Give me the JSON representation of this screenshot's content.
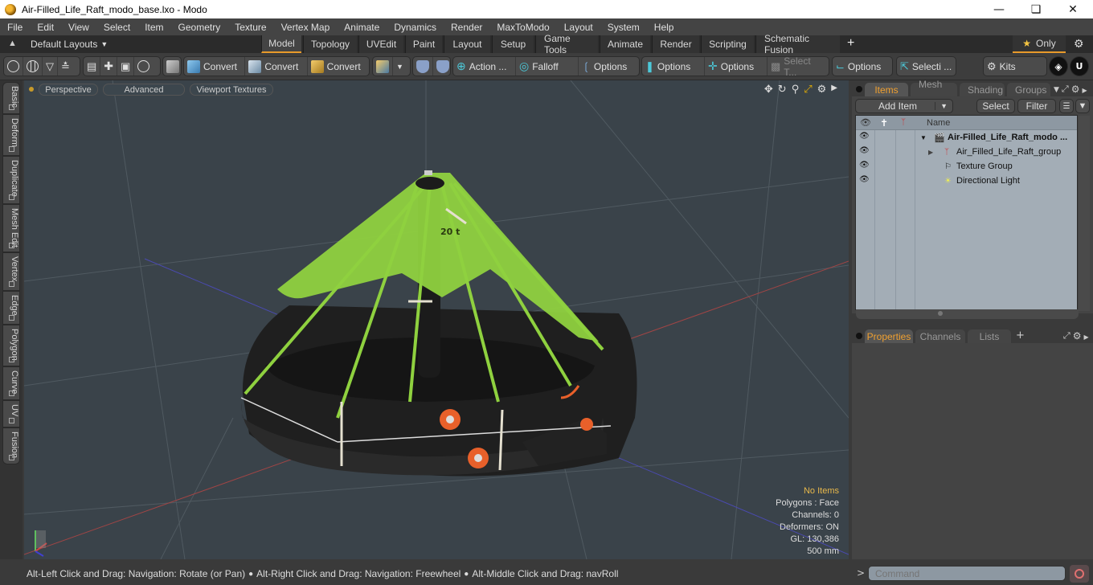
{
  "window": {
    "title": "Air-Filled_Life_Raft_modo_base.lxo - Modo",
    "controls": [
      "minimize",
      "maximize",
      "close"
    ]
  },
  "menu": [
    "File",
    "Edit",
    "View",
    "Select",
    "Item",
    "Geometry",
    "Texture",
    "Vertex Map",
    "Animate",
    "Dynamics",
    "Render",
    "MaxToModo",
    "Layout",
    "System",
    "Help"
  ],
  "layout_bar": {
    "layouts_dropdown": "Default Layouts",
    "tabs": [
      "Model",
      "Topology",
      "UVEdit",
      "Paint",
      "Layout",
      "Setup",
      "Game Tools",
      "Animate",
      "Render",
      "Scripting",
      "Schematic Fusion"
    ],
    "active_tab": "Model",
    "add_tab": "+",
    "only_label": "Only"
  },
  "toolbar": {
    "convert1": "Convert",
    "convert2": "Convert",
    "convert3": "Convert",
    "action": "Action ...",
    "falloff": "Falloff",
    "options1": "Options",
    "options2": "Options",
    "options3": "Options",
    "select_t": "Select T...",
    "options4": "Options",
    "selecti": "Selecti ...",
    "kits": "Kits"
  },
  "left_tabs": [
    "Basic",
    "Deform",
    "Duplicate",
    "Mesh Edit",
    "Vertex",
    "Edge",
    "Polygon",
    "Curve",
    "UV",
    "Fusion"
  ],
  "viewport": {
    "view_mode": "Perspective",
    "shading": "Advanced",
    "textures": "Viewport Textures",
    "info": {
      "selection": "No Items",
      "polygons": "Polygons : Face",
      "channels": "Channels: 0",
      "deformers": "Deformers: ON",
      "gl": "GL: 130,386",
      "scale": "500 mm"
    },
    "model_label": "20 t"
  },
  "status_bar": {
    "hint1": "Alt-Left Click and Drag: Navigation: Rotate (or Pan)",
    "hint2": "Alt-Right Click and Drag: Navigation: Freewheel",
    "hint3": "Alt-Middle Click and Drag: navRoll"
  },
  "items_panel": {
    "tabs": [
      "Items",
      "Mesh ...",
      "Shading",
      "Groups"
    ],
    "active_tab": "Items",
    "add_item": "Add Item",
    "select": "Select",
    "filter": "Filter",
    "column_name": "Name",
    "rows": [
      {
        "name": "Air-Filled_Life_Raft_modo ...",
        "icon": "scene-icon",
        "bold": true
      },
      {
        "name": "Air_Filled_Life_Raft_group",
        "icon": "group-locator-icon",
        "bold": false
      },
      {
        "name": "Texture Group",
        "icon": "texture-group-icon",
        "bold": false
      },
      {
        "name": "Directional Light",
        "icon": "light-icon",
        "bold": false
      }
    ]
  },
  "properties_panel": {
    "tabs": [
      "Properties",
      "Channels",
      "Lists"
    ],
    "active_tab": "Properties",
    "add_tab": "+"
  },
  "command": {
    "prompt": ">",
    "placeholder": "Command"
  },
  "colors": {
    "accent": "#e89a2a",
    "viewport_bg": "#3a434a",
    "items_bg": "#a3adb6",
    "raft_green": "#8fd13f",
    "raft_black": "#262626",
    "raft_orange": "#e8602a"
  }
}
